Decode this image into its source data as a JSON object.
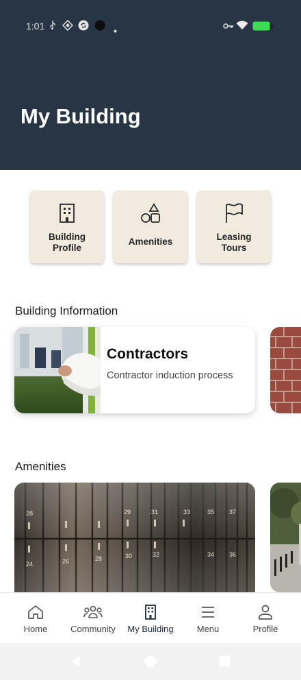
{
  "status_bar": {
    "time": "1:01",
    "icons": [
      "usb-icon",
      "vpn-icon",
      "sync-icon",
      "circle-icon",
      "dot-icon",
      "key-icon",
      "wifi-icon",
      "battery-charging-icon"
    ],
    "battery_color": "#3ddc57"
  },
  "header": {
    "title": "My Building",
    "background": "#273545"
  },
  "quick_actions": [
    {
      "label_line1": "Building",
      "label_line2": "Profile",
      "icon": "building-icon"
    },
    {
      "label_line1": "Amenities",
      "label_line2": "",
      "icon": "shapes-icon"
    },
    {
      "label_line1": "Leasing",
      "label_line2": "Tours",
      "icon": "flag-icon"
    }
  ],
  "building_information": {
    "section_title": "Building Information",
    "cards": [
      {
        "title": "Contractors",
        "description": "Contractor induction process",
        "image": "hard-hat-photo"
      },
      {
        "title": "",
        "description": "",
        "image": "brick-wall-photo"
      }
    ]
  },
  "amenities": {
    "section_title": "Amenities",
    "cards": [
      {
        "image": "lockers-photo",
        "locker_numbers": [
          "28",
          "29",
          "31",
          "33",
          "35",
          "37",
          "24",
          "26",
          "28",
          "30",
          "32",
          "34",
          "36"
        ]
      },
      {
        "image": "outdoor-plaza-photo"
      }
    ]
  },
  "bottom_nav": {
    "items": [
      {
        "label": "Home",
        "icon": "home-icon",
        "active": false
      },
      {
        "label": "Community",
        "icon": "community-icon",
        "active": false
      },
      {
        "label": "My Building",
        "icon": "building-icon",
        "active": true
      },
      {
        "label": "Menu",
        "icon": "menu-icon",
        "active": false
      },
      {
        "label": "Profile",
        "icon": "profile-icon",
        "active": false
      }
    ]
  },
  "system_nav": [
    "back-icon",
    "home-circle-icon",
    "recents-icon"
  ]
}
